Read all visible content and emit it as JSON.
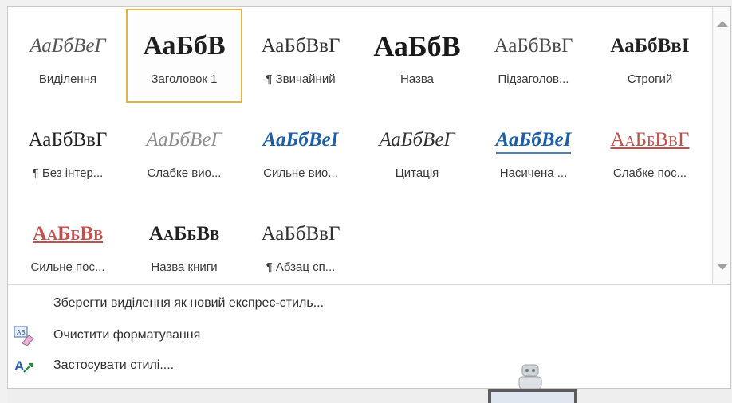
{
  "styles": [
    {
      "preview": "АаБбВеГ",
      "label": "Виділення"
    },
    {
      "preview": "АаБбВ",
      "label": "Заголовок 1"
    },
    {
      "preview": "АаБбВвГ",
      "label": "¶ Звичайний"
    },
    {
      "preview": "АаБбВ",
      "label": "Назва"
    },
    {
      "preview": "АаБбВвГ",
      "label": "Підзаголов..."
    },
    {
      "preview": "АаБбВвІ",
      "label": "Строгий"
    },
    {
      "preview": "АаБбВвГ",
      "label": "¶ Без інтер..."
    },
    {
      "preview": "АаБбВеГ",
      "label": "Слабке вио..."
    },
    {
      "preview": "АаБбВеІ",
      "label": "Сильне вио..."
    },
    {
      "preview": "АаБбВеГ",
      "label": "Цитація"
    },
    {
      "preview": "АаБбВеІ",
      "label": "Насичена ..."
    },
    {
      "preview": "АаБбВвГ",
      "label": "Слабке пос..."
    },
    {
      "preview": "АаБбВв",
      "label": "Сильне пос..."
    },
    {
      "preview": "АаБбВв",
      "label": "Назва книги"
    },
    {
      "preview": "АаБбВвГ",
      "label": "¶ Абзац сп..."
    }
  ],
  "commands": {
    "save_selection": "Зберегти виділення як новий експрес-стиль...",
    "clear_formatting": "Очистити форматування",
    "apply_styles": "Застосувати стилі...."
  },
  "icons": {
    "clear_formatting": "clear-formatting-icon",
    "apply_styles": "apply-styles-icon",
    "scroll_up": "scroll-up-icon",
    "scroll_down": "scroll-down-icon"
  },
  "colors": {
    "selection_border": "#e0b44b",
    "emphasis_blue": "#1f5fa6",
    "reference_red": "#c0504d",
    "subtle_gray": "#8c8c8c"
  }
}
